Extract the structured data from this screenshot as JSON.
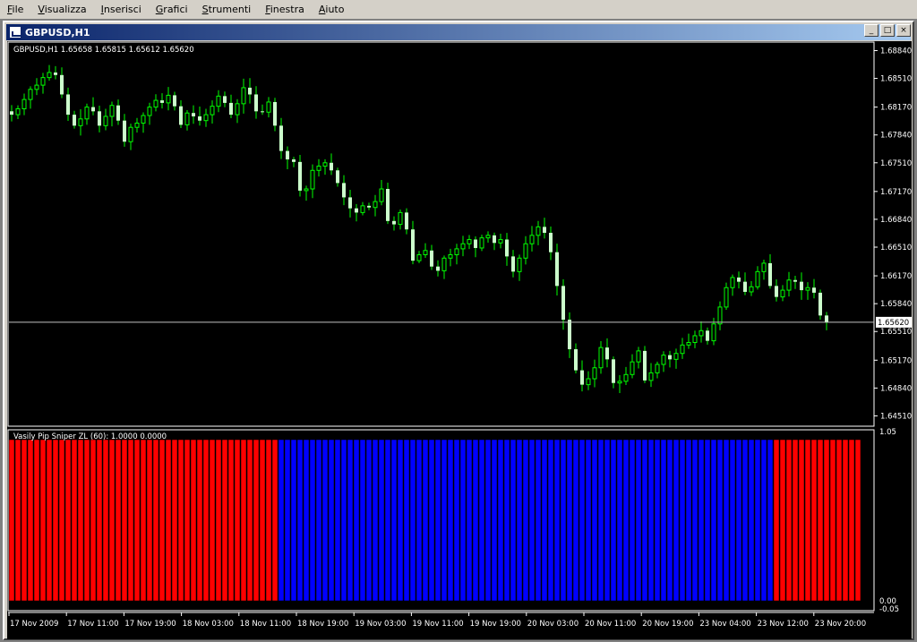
{
  "menu": [
    {
      "label": "File",
      "underline": "F",
      "rest": "ile"
    },
    {
      "label": "Visualizza",
      "underline": "V",
      "rest": "isualizza"
    },
    {
      "label": "Inserisci",
      "underline": "I",
      "rest": "nserisci"
    },
    {
      "label": "Grafici",
      "underline": "G",
      "rest": "rafici"
    },
    {
      "label": "Strumenti",
      "underline": "S",
      "rest": "trumenti"
    },
    {
      "label": "Finestra",
      "underline": "F",
      "rest": "inestra"
    },
    {
      "label": "Aiuto",
      "underline": "A",
      "rest": "iuto"
    }
  ],
  "window": {
    "title": "GBPUSD,H1",
    "buttons": {
      "minimize": "_",
      "maximize": "□",
      "close": "×"
    }
  },
  "chart_data": [
    {
      "type": "candlestick",
      "header": "GBPUSD,H1  1.65658 1.65815 1.65612 1.65620",
      "price_ticks": [
        "1.68840",
        "1.68510",
        "1.68170",
        "1.67840",
        "1.67510",
        "1.67170",
        "1.66840",
        "1.66510",
        "1.66170",
        "1.65840",
        "1.65510",
        "1.65170",
        "1.64840",
        "1.64510"
      ],
      "price_tick_values": [
        1.6884,
        1.6851,
        1.6817,
        1.6784,
        1.6751,
        1.6717,
        1.6684,
        1.6651,
        1.6617,
        1.6584,
        1.6551,
        1.6517,
        1.6484,
        1.6451
      ],
      "ylim": [
        1.6443,
        1.6893
      ],
      "current_price": "1.65620",
      "current_price_value": 1.6562,
      "candle_color": "#ccffcc",
      "wick_color": "#00ff00",
      "closes": [
        1.6808,
        1.6815,
        1.6826,
        1.6838,
        1.6843,
        1.6852,
        1.6858,
        1.6855,
        1.6832,
        1.6808,
        1.6795,
        1.6803,
        1.6817,
        1.6812,
        1.6795,
        1.6806,
        1.6819,
        1.6801,
        1.6776,
        1.6793,
        1.6798,
        1.6807,
        1.6817,
        1.6825,
        1.6822,
        1.6831,
        1.6818,
        1.6796,
        1.681,
        1.6806,
        1.6801,
        1.6808,
        1.6818,
        1.683,
        1.6822,
        1.6808,
        1.6821,
        1.684,
        1.6832,
        1.6812,
        1.6811,
        1.6823,
        1.6795,
        1.6765,
        1.6755,
        1.6752,
        1.6718,
        1.672,
        1.6742,
        1.6747,
        1.6751,
        1.6742,
        1.6727,
        1.671,
        1.6697,
        1.6692,
        1.67,
        1.6698,
        1.6705,
        1.672,
        1.6682,
        1.6678,
        1.6692,
        1.6672,
        1.6635,
        1.6642,
        1.6647,
        1.6628,
        1.6623,
        1.6638,
        1.6642,
        1.6649,
        1.6655,
        1.666,
        1.665,
        1.6662,
        1.6665,
        1.6656,
        1.666,
        1.664,
        1.6622,
        1.6638,
        1.6655,
        1.6665,
        1.6675,
        1.6668,
        1.6645,
        1.6605,
        1.6565,
        1.653,
        1.6505,
        1.6488,
        1.6495,
        1.6508,
        1.6532,
        1.6518,
        1.649,
        1.6492,
        1.65,
        1.6515,
        1.6528,
        1.6493,
        1.6502,
        1.6512,
        1.6523,
        1.6518,
        1.6525,
        1.6535,
        1.6538,
        1.6546,
        1.6552,
        1.654,
        1.656,
        1.658,
        1.6603,
        1.6615,
        1.661,
        1.6598,
        1.6604,
        1.6622,
        1.6632,
        1.6605,
        1.6592,
        1.66,
        1.6612,
        1.661,
        1.66,
        1.6603,
        1.6597,
        1.657,
        1.6562
      ]
    },
    {
      "type": "bar",
      "header": "Vasily Pip Sniper ZL (60):  1.0000 0.0000",
      "yticks": [
        "1.05",
        "0.00",
        "-0.05"
      ],
      "ylim": [
        -0.05,
        1.05
      ],
      "series": [
        {
          "color": "#ff0000",
          "count": 43
        },
        {
          "color": "#0000ff",
          "count": 79
        },
        {
          "color": "#ff0000",
          "count": 14
        }
      ]
    }
  ],
  "time_axis": [
    "17 Nov 2009",
    "17 Nov 11:00",
    "17 Nov 19:00",
    "18 Nov 03:00",
    "18 Nov 11:00",
    "18 Nov 19:00",
    "19 Nov 03:00",
    "19 Nov 11:00",
    "19 Nov 19:00",
    "20 Nov 03:00",
    "20 Nov 11:00",
    "20 Nov 19:00",
    "23 Nov 04:00",
    "23 Nov 12:00",
    "23 Nov 20:00"
  ],
  "colors": {
    "background": "#000000",
    "axis": "#ffffff",
    "grid_line": "#c0c0c0"
  }
}
